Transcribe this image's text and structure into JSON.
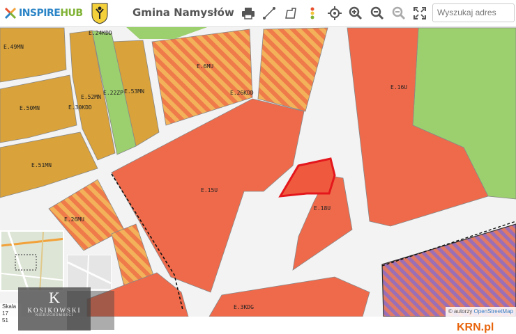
{
  "header": {
    "brand_left": "INSPIRE",
    "brand_right": "HUB",
    "municipality": "Gmina Namysłów",
    "search_placeholder": "Wyszukaj adres",
    "tools": [
      {
        "name": "print-icon",
        "glyph": "⎙"
      },
      {
        "name": "measure-line-icon",
        "glyph": "⟋"
      },
      {
        "name": "measure-area-icon",
        "glyph": "⏢"
      },
      {
        "name": "legend-icon",
        "glyph": "⋮"
      },
      {
        "name": "locate-icon",
        "glyph": "⊕"
      },
      {
        "name": "zoom-in-icon",
        "glyph": "⊕"
      },
      {
        "name": "zoom-out-icon",
        "glyph": "⊖"
      },
      {
        "name": "zoom-extent-icon",
        "glyph": "⊖"
      },
      {
        "name": "fullscreen-icon",
        "glyph": "⛶"
      }
    ]
  },
  "map": {
    "zone_labels": [
      {
        "id": "E.49MN",
        "text": "E.49MN"
      },
      {
        "id": "E.24KDD",
        "text": "E.24KDD"
      },
      {
        "id": "E.6MU",
        "text": "E.6MU"
      },
      {
        "id": "E.26KDD",
        "text": "E.26KDD"
      },
      {
        "id": "E.52MN",
        "text": "E.52MN"
      },
      {
        "id": "E.22ZP",
        "text": "E.22ZP"
      },
      {
        "id": "E.53MN",
        "text": "E.53MN"
      },
      {
        "id": "E.50MN",
        "text": "E.50MN"
      },
      {
        "id": "E.30KDD",
        "text": "E.30KDD"
      },
      {
        "id": "E.51MN",
        "text": "E.51MN"
      },
      {
        "id": "E.16U",
        "text": "E.16U"
      },
      {
        "id": "E.15U",
        "text": "E.15U"
      },
      {
        "id": "E.18U",
        "text": "E.18U"
      },
      {
        "id": "E.26MU",
        "text": "E.26MU"
      },
      {
        "id": "E.3KDG",
        "text": "E.3KDG"
      }
    ],
    "colors": {
      "mn_residential": "#d9a23a",
      "u_services": "#ef6a4b",
      "green_zp": "#9ccf6e",
      "mu_hatch_a": "#ef7a4a",
      "mu_hatch_b": "#f3b25a",
      "purple_hatch_a": "#9b6fb5",
      "purple_hatch_b": "#e07a66",
      "selected_parcel": "#e4171c"
    },
    "scale_text": [
      "Skala",
      "17",
      "51"
    ]
  },
  "watermark": {
    "mark": "K",
    "name": "KOSIKOWSKI",
    "sub": "NIERUCHOMOŚCI"
  },
  "footer": {
    "attribution_prefix": "© autorzy",
    "attribution_link": "OpenStreetMap",
    "site_logo": "KRN.pl"
  }
}
